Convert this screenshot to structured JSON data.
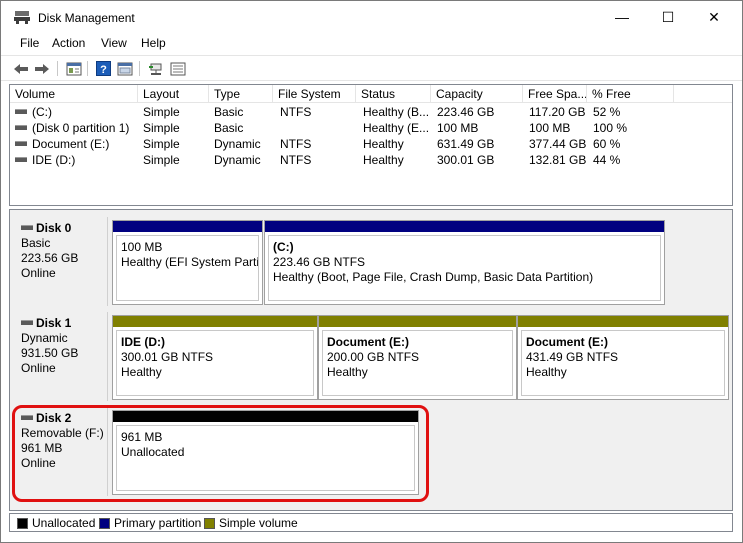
{
  "window": {
    "title": "Disk Management"
  },
  "menu": [
    "File",
    "Action",
    "View",
    "Help"
  ],
  "volume_list": {
    "columns": [
      "Volume",
      "Layout",
      "Type",
      "File System",
      "Status",
      "Capacity",
      "Free Spa...",
      "% Free"
    ],
    "rows": [
      [
        "(C:)",
        "Simple",
        "Basic",
        "NTFS",
        "Healthy (B...",
        "223.46 GB",
        "117.20 GB",
        "52 %"
      ],
      [
        "(Disk 0 partition 1)",
        "Simple",
        "Basic",
        "",
        "Healthy (E...",
        "100 MB",
        "100 MB",
        "100 %"
      ],
      [
        "Document (E:)",
        "Simple",
        "Dynamic",
        "NTFS",
        "Healthy",
        "631.49 GB",
        "377.44 GB",
        "60 %"
      ],
      [
        "IDE (D:)",
        "Simple",
        "Dynamic",
        "NTFS",
        "Healthy",
        "300.01 GB",
        "132.81 GB",
        "44 %"
      ]
    ]
  },
  "disks": [
    {
      "name": "Disk 0",
      "type": "Basic",
      "size": "223.56 GB",
      "status": "Online",
      "partitions": [
        {
          "name": "",
          "size": "100 MB",
          "status": "Healthy (EFI System Partiti"
        },
        {
          "name": "(C:)",
          "size": "223.46 GB NTFS",
          "status": "Healthy (Boot, Page File, Crash Dump, Basic Data Partition)"
        }
      ]
    },
    {
      "name": "Disk 1",
      "type": "Dynamic",
      "size": "931.50 GB",
      "status": "Online",
      "partitions": [
        {
          "name": "IDE  (D:)",
          "size": "300.01 GB NTFS",
          "status": "Healthy"
        },
        {
          "name": "Document  (E:)",
          "size": "200.00 GB NTFS",
          "status": "Healthy"
        },
        {
          "name": "Document  (E:)",
          "size": "431.49 GB NTFS",
          "status": "Healthy"
        }
      ]
    },
    {
      "name": "Disk 2",
      "type": "Removable (F:)",
      "size": "961 MB",
      "status": "Online",
      "partitions": [
        {
          "name": "",
          "size": "961 MB",
          "status": "Unallocated"
        }
      ]
    }
  ],
  "legend": [
    "Unallocated",
    "Primary partition",
    "Simple volume"
  ],
  "colors": {
    "unallocated": "#000000",
    "primary": "#000080",
    "simple": "#808000",
    "highlight": "#e01010"
  },
  "icons": {
    "window_min": "—",
    "window_max": "☐",
    "window_close": "✕"
  }
}
